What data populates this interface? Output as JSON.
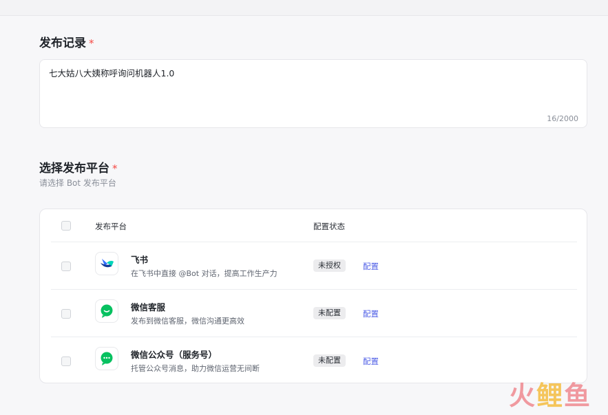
{
  "release_record": {
    "title": "发布记录",
    "required_mark": "*",
    "value": "七大姑八大姨称呼询问机器人1.0",
    "char_count": "16/2000"
  },
  "platform_section": {
    "title": "选择发布平台",
    "required_mark": "*",
    "subtitle": "请选择 Bot 发布平台"
  },
  "table": {
    "headers": {
      "platform": "发布平台",
      "status": "配置状态"
    },
    "rows": [
      {
        "name": "飞书",
        "description": "在飞书中直接 @Bot 对话，提高工作生产力",
        "status": "未授权",
        "action": "配置",
        "icon": "feishu-logo-icon"
      },
      {
        "name": "微信客服",
        "description": "发布到微信客服，微信沟通更高效",
        "status": "未配置",
        "action": "配置",
        "icon": "wechat-logo-icon"
      },
      {
        "name": "微信公众号（服务号）",
        "description": "托管公众号消息，助力微信运营无间断",
        "status": "未配置",
        "action": "配置",
        "icon": "wechat-logo-icon"
      }
    ]
  },
  "watermark": {
    "p1": "火",
    "p2": "鲤",
    "p3": "鱼"
  },
  "colors": {
    "accent_link": "#4e5ee6",
    "required": "#f54a45",
    "wechat_green": "#07c160"
  }
}
